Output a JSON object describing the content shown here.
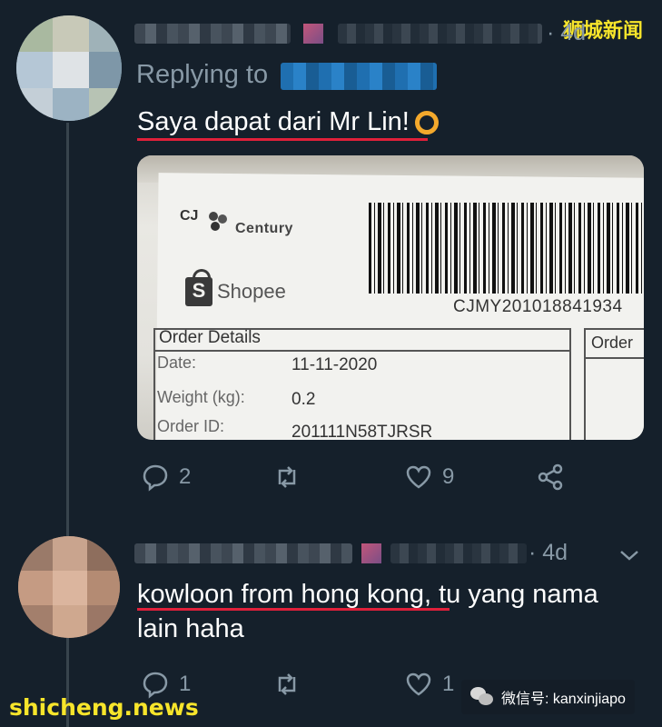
{
  "watermarks": {
    "top_right": "狮城新闻",
    "bottom_left": "shicheng.news",
    "wechat": "微信号: kanxinjiapo"
  },
  "tweet1": {
    "timestamp": "· 4d",
    "replying_to_label": "Replying to",
    "text": "Saya dapat dari Mr Lin!",
    "emoji": "ok-hand",
    "photo": {
      "carrier": "CJ",
      "carrier_sub": "Century",
      "shop": "Shopee",
      "tracking": "CJMY201018841934",
      "order_details_title": "Order Details",
      "order_side_title": "Order",
      "rows": [
        {
          "label": "Date:",
          "value": "11-11-2020"
        },
        {
          "label": "Weight (kg):",
          "value": "0.2"
        },
        {
          "label": "Order ID:",
          "value": "201111N58TJRSR"
        }
      ]
    },
    "replies": "2",
    "retweets": "",
    "likes": "9"
  },
  "tweet2": {
    "timestamp": "· 4d",
    "text_line1": "kowloon from hong kong, tu yang nama",
    "text_line2": "lain haha",
    "replies": "1",
    "retweets": "",
    "likes": "1"
  },
  "colors": {
    "background": "#15202b",
    "muted": "#8899a6",
    "underline": "#e0203a",
    "watermark": "#f7e52b"
  }
}
